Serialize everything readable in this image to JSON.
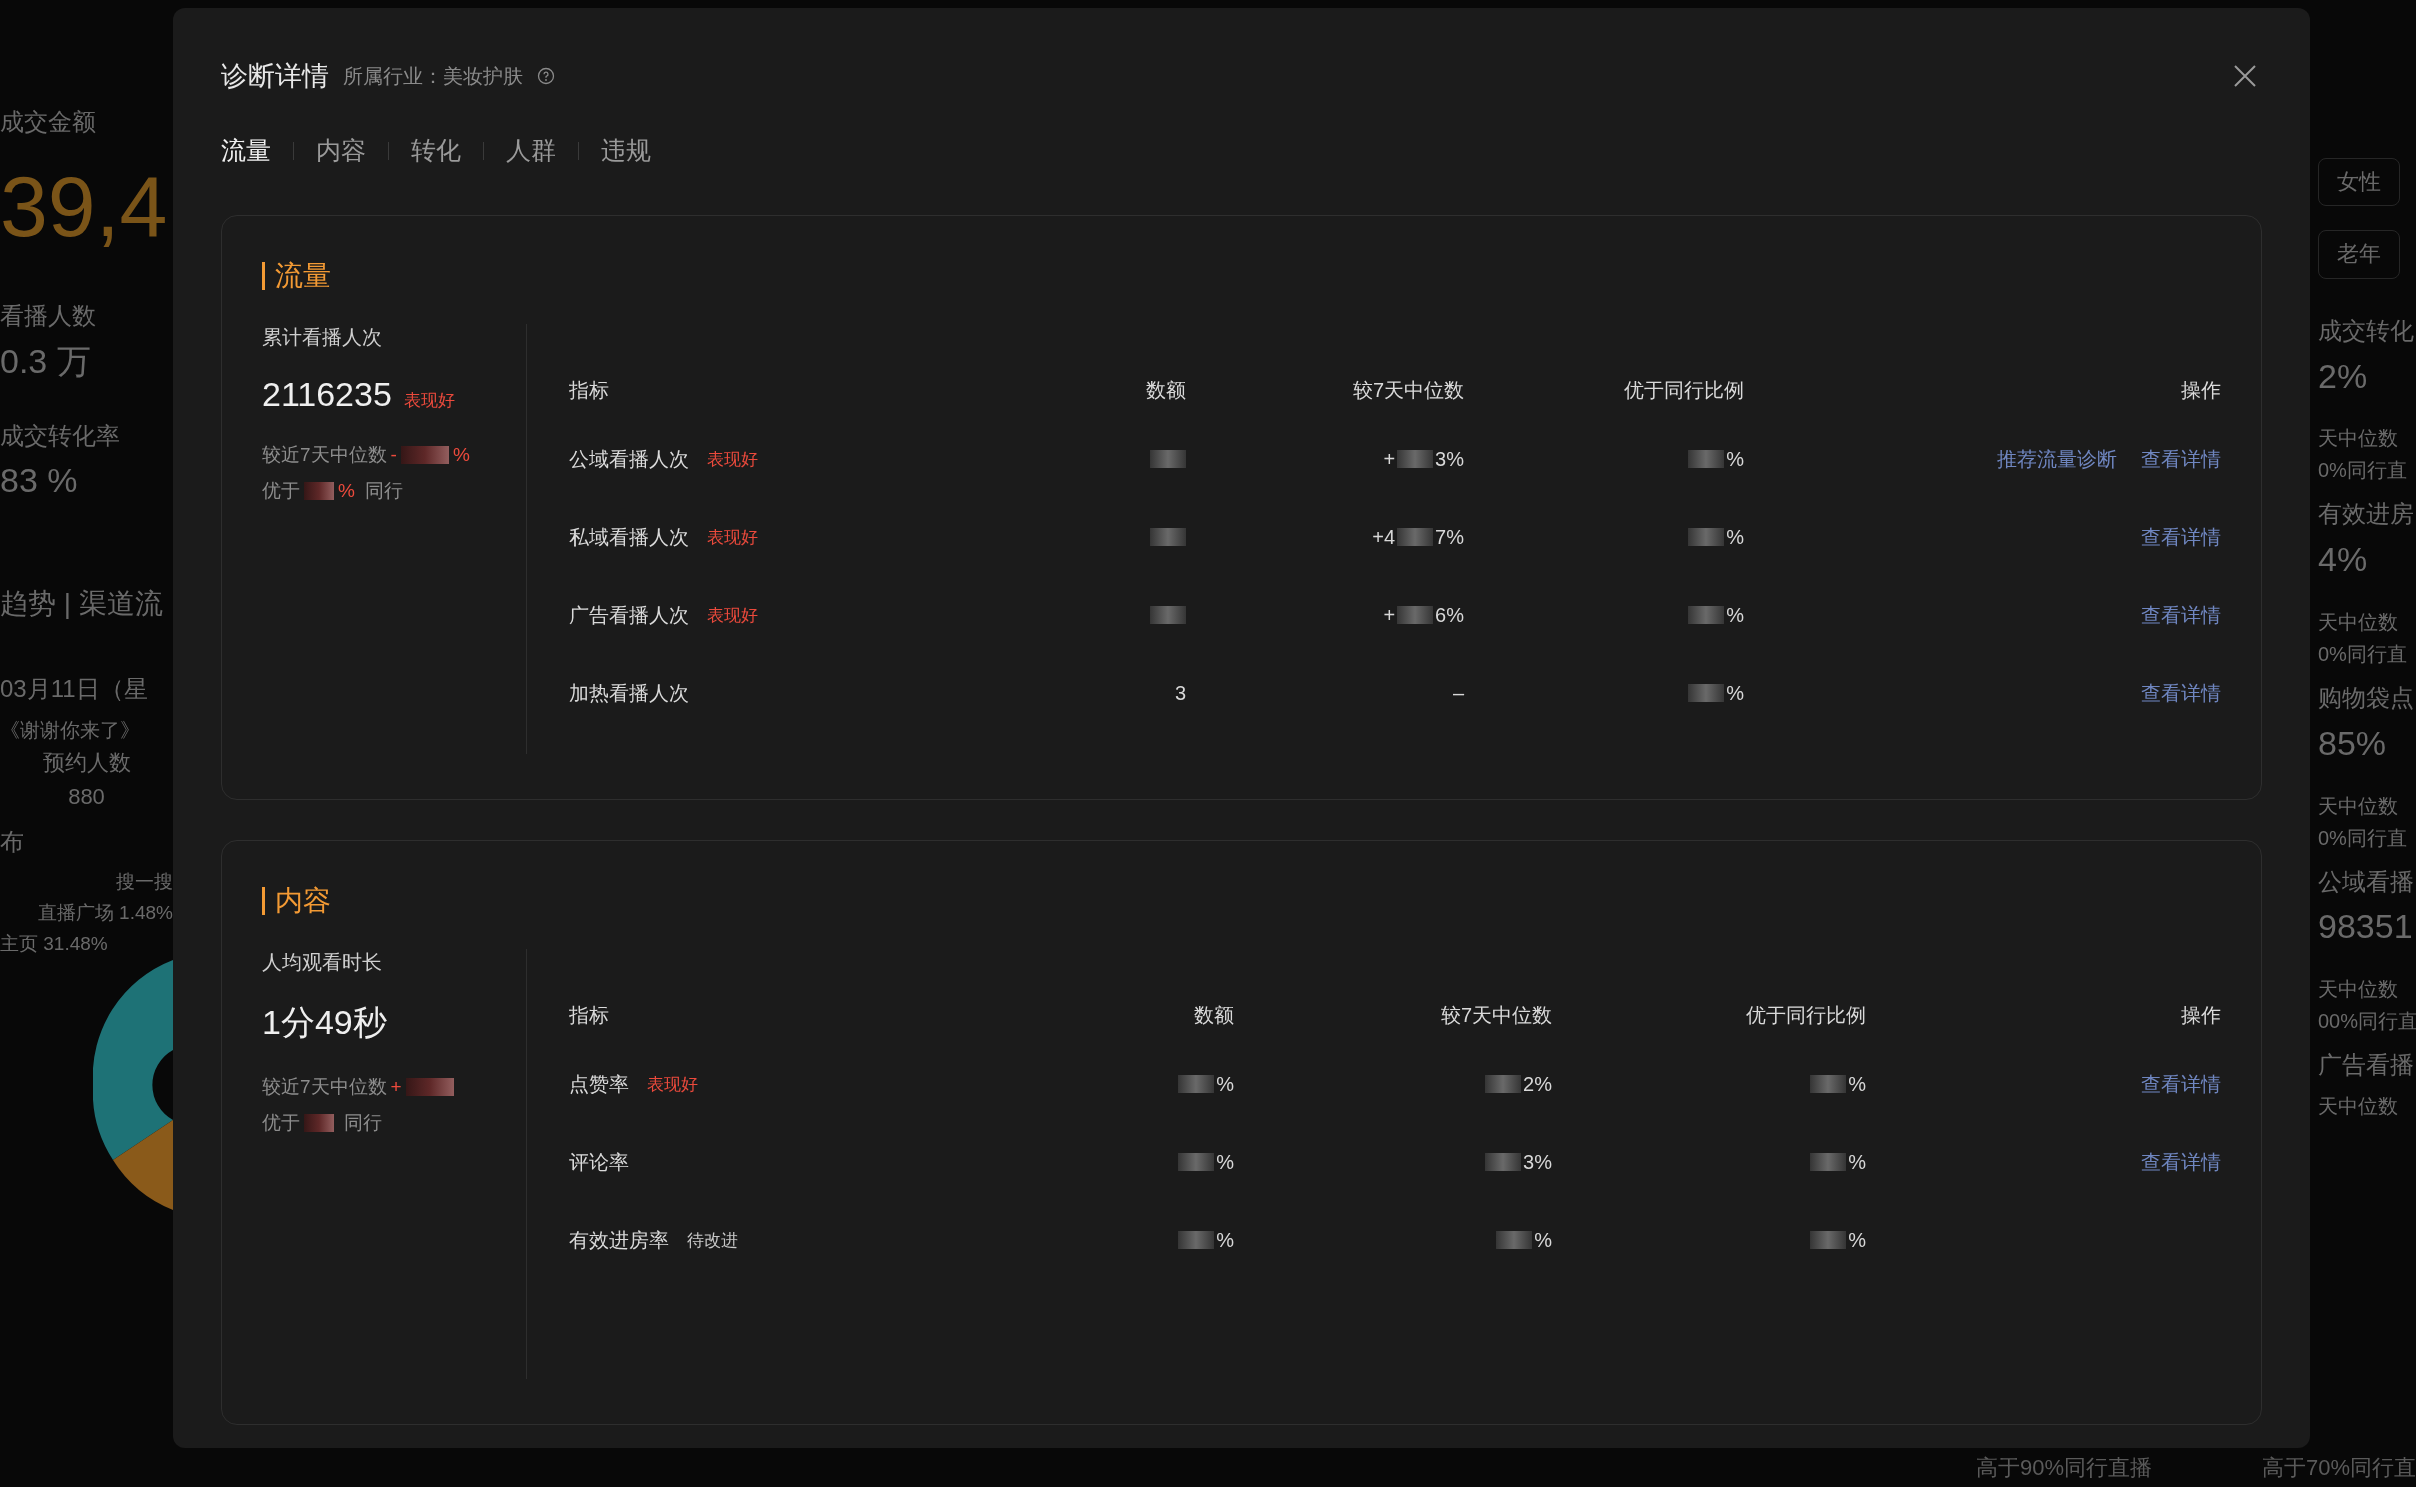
{
  "background": {
    "left": [
      {
        "kind": "label",
        "text": "成交金额"
      },
      {
        "kind": "big",
        "text": "39,4"
      },
      {
        "kind": "label",
        "text": "看播人数"
      },
      {
        "kind": "value",
        "text": "0.3 万"
      },
      {
        "kind": "label",
        "text": "成交转化率"
      },
      {
        "kind": "value",
        "text": "83 %"
      },
      {
        "kind": "tabs",
        "text": "趋势  |  渠道流"
      },
      {
        "kind": "label",
        "text": "03月11日（星"
      },
      {
        "kind": "small",
        "text": "《谢谢你来了》"
      },
      {
        "kind": "center",
        "text": "预约人数"
      },
      {
        "kind": "center",
        "text": "880"
      },
      {
        "kind": "label",
        "text": "布"
      },
      {
        "kind": "legend",
        "text": "搜一搜"
      },
      {
        "kind": "legend",
        "text": "直播广场 1.48%"
      },
      {
        "kind": "legendleft",
        "text": "主页 31.48%"
      }
    ],
    "right": [
      {
        "kind": "chip",
        "text": "女性"
      },
      {
        "kind": "chip",
        "text": "老年"
      },
      {
        "kind": "label",
        "text": "成交转化"
      },
      {
        "kind": "value",
        "text": "2%"
      },
      {
        "kind": "small",
        "text": "天中位数"
      },
      {
        "kind": "small",
        "text": "0%同行直"
      },
      {
        "kind": "label",
        "text": "有效进房"
      },
      {
        "kind": "value",
        "text": "4%"
      },
      {
        "kind": "small",
        "text": "天中位数"
      },
      {
        "kind": "small",
        "text": "0%同行直"
      },
      {
        "kind": "label",
        "text": "购物袋点"
      },
      {
        "kind": "value",
        "text": "85%"
      },
      {
        "kind": "small",
        "text": "天中位数"
      },
      {
        "kind": "small",
        "text": "0%同行直"
      },
      {
        "kind": "label",
        "text": "公域看播"
      },
      {
        "kind": "value",
        "text": "98351"
      },
      {
        "kind": "small",
        "text": "天中位数"
      },
      {
        "kind": "small",
        "text": "00%同行直"
      },
      {
        "kind": "label",
        "text": "广告看播"
      },
      {
        "kind": "small",
        "text": "天中位数"
      }
    ],
    "bottom": [
      "高于90%同行直播",
      "高于70%同行直"
    ]
  },
  "dialog": {
    "title": "诊断详情",
    "industry": "所属行业：美妆护肤",
    "tabs": [
      {
        "label": "流量",
        "selected": true
      },
      {
        "label": "内容",
        "selected": false
      },
      {
        "label": "转化",
        "selected": false
      },
      {
        "label": "人群",
        "selected": false
      },
      {
        "label": "违规",
        "selected": false
      }
    ],
    "sections": [
      {
        "title": "流量",
        "summary": {
          "label": "累计看播人次",
          "value": "2116235",
          "badge": {
            "text": "表现好",
            "kind": "good"
          },
          "compare": {
            "text": "较近7天中位数",
            "delta": "-",
            "unit": "%"
          },
          "rank": {
            "prefix": "优于",
            "unit": "%",
            "suffix": "同行"
          }
        },
        "columns": [
          "指标",
          "数额",
          "较7天中位数",
          "优于同行比例",
          "操作"
        ],
        "rows": [
          {
            "cells": [
              {
                "text": "公域看播人次",
                "badge": {
                  "text": "表现好",
                  "kind": "good"
                }
              },
              {
                "redacted": true
              },
              {
                "prefix": "+",
                "redacted": true,
                "text": "3%"
              },
              {
                "redacted": true,
                "text": "%"
              },
              {
                "actions": [
                  "推荐流量诊断",
                  "查看详情"
                ]
              }
            ]
          },
          {
            "cells": [
              {
                "text": "私域看播人次",
                "badge": {
                  "text": "表现好",
                  "kind": "good"
                }
              },
              {
                "redacted": true
              },
              {
                "prefix": "+4",
                "redacted": true,
                "text": "7%"
              },
              {
                "redacted": true,
                "text": "%"
              },
              {
                "actions": [
                  "查看详情"
                ]
              }
            ]
          },
          {
            "cells": [
              {
                "text": "广告看播人次",
                "badge": {
                  "text": "表现好",
                  "kind": "good"
                }
              },
              {
                "redacted": true
              },
              {
                "prefix": "+",
                "redacted": true,
                "text": "6%"
              },
              {
                "redacted": true,
                "text": "%"
              },
              {
                "actions": [
                  "查看详情"
                ]
              }
            ]
          },
          {
            "cells": [
              {
                "text": "加热看播人次"
              },
              {
                "redacted": false,
                "text": "3"
              },
              {
                "redacted": false,
                "text": "–"
              },
              {
                "redacted": true,
                "text": "%"
              },
              {
                "actions": [
                  "查看详情"
                ]
              }
            ]
          }
        ]
      },
      {
        "title": "内容",
        "summary": {
          "label": "人均观看时长",
          "value": "1分49秒",
          "compare": {
            "text": "较近7天中位数",
            "delta": "+"
          },
          "rank": {
            "prefix": "优于",
            "suffix": "同行"
          }
        },
        "columns": [
          "指标",
          "数额",
          "较7天中位数",
          "优于同行比例",
          "操作"
        ],
        "rows": [
          {
            "cells": [
              {
                "text": "点赞率",
                "badge": {
                  "text": "表现好",
                  "kind": "good"
                }
              },
              {
                "redacted": true,
                "text": "%"
              },
              {
                "redacted": true,
                "text": "2%"
              },
              {
                "redacted": true,
                "text": "%"
              },
              {
                "actions": [
                  "查看详情"
                ]
              }
            ]
          },
          {
            "cells": [
              {
                "text": "评论率"
              },
              {
                "redacted": true,
                "text": "%"
              },
              {
                "redacted": true,
                "text": "3%"
              },
              {
                "redacted": true,
                "text": "%"
              },
              {
                "actions": [
                  "查看详情"
                ]
              }
            ]
          },
          {
            "cells": [
              {
                "text": "有效进房率",
                "badge": {
                  "text": "待改进",
                  "kind": "improve"
                }
              },
              {
                "redacted": true,
                "text": "%"
              },
              {
                "redacted": true,
                "text": "%"
              },
              {
                "redacted": true,
                "text": "%"
              }
            ]
          }
        ]
      }
    ]
  }
}
